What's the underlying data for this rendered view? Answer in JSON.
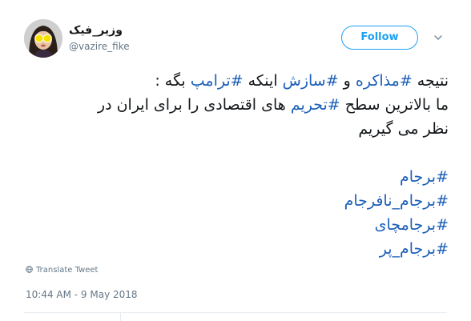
{
  "author": {
    "display_name": "وزیر_فیک",
    "handle": "@vazire_fike"
  },
  "follow_label": "Follow",
  "tweet": {
    "line1": {
      "t1": "نتیجه ",
      "h1": "#مذاکره",
      "t2": " و ",
      "h2": "#سازش",
      "t3": " اینکه ",
      "h3": "#ترامپ",
      "t4": " بگه :"
    },
    "line2": {
      "t1": "ما بالاترین سطح ",
      "h1": "#تحریم",
      "t2": " های اقتصادی  را برای ایران در"
    },
    "line3": "نظر می گیریم",
    "hashtags": [
      "#برجام",
      "#برجام_نافرجام",
      "#برجامچای",
      "#برجام_پر"
    ]
  },
  "translate_label": "Translate Tweet",
  "timestamp": "10:44 AM - 9 May 2018",
  "colors": {
    "accent": "#1da1f2",
    "hashtag": "#1b5eb8",
    "secondary_text": "#657786"
  }
}
